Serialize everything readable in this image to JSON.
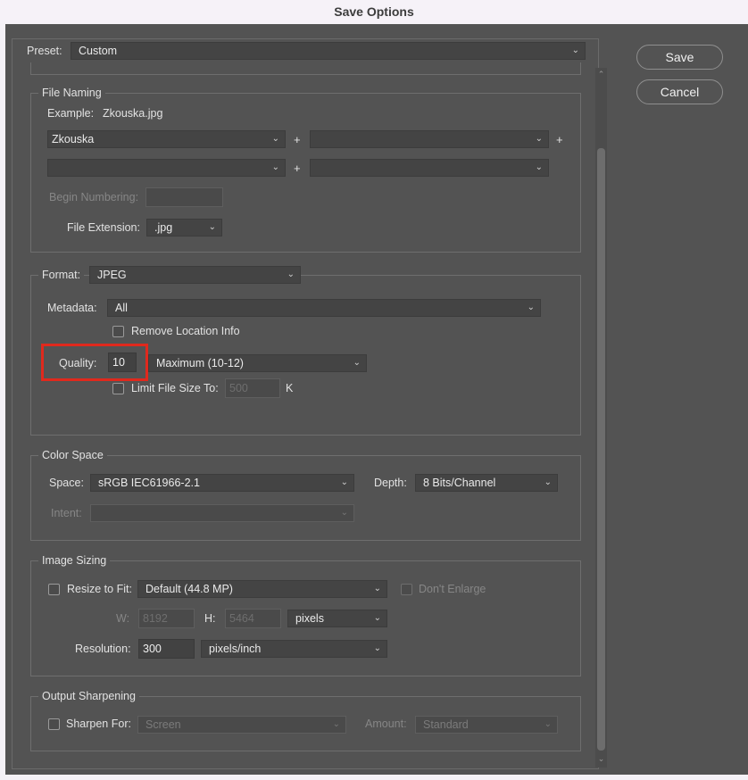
{
  "window": {
    "title": "Save Options"
  },
  "buttons": {
    "save": "Save",
    "cancel": "Cancel"
  },
  "preset": {
    "label": "Preset:",
    "value": "Custom"
  },
  "file_naming": {
    "legend": "File Naming",
    "example_label": "Example:",
    "example_value": "Zkouska.jpg",
    "name_field_1": "Zkouska",
    "name_field_2": "",
    "name_field_3": "",
    "name_field_4": "",
    "plus": "+",
    "begin_numbering_label": "Begin Numbering:",
    "begin_numbering_value": "",
    "extension_label": "File Extension:",
    "extension_value": ".jpg"
  },
  "format": {
    "label": "Format:",
    "value": "JPEG",
    "metadata_label": "Metadata:",
    "metadata_value": "All",
    "remove_location_label": "Remove Location Info",
    "remove_location_checked": false,
    "quality_label": "Quality:",
    "quality_value": "10",
    "quality_preset": "Maximum  (10-12)",
    "limit_size_label": "Limit File Size To:",
    "limit_size_checked": false,
    "limit_size_value": "500",
    "limit_size_unit": "K",
    "highlight_color": "#e0291d"
  },
  "color_space": {
    "legend": "Color Space",
    "space_label": "Space:",
    "space_value": "sRGB IEC61966-2.1",
    "depth_label": "Depth:",
    "depth_value": "8 Bits/Channel",
    "intent_label": "Intent:",
    "intent_value": ""
  },
  "image_sizing": {
    "legend": "Image Sizing",
    "resize_label": "Resize to Fit:",
    "resize_checked": false,
    "resize_value": "Default  (44.8 MP)",
    "dont_enlarge_label": "Don't Enlarge",
    "dont_enlarge_checked": false,
    "w_label": "W:",
    "w_value": "8192",
    "h_label": "H:",
    "h_value": "5464",
    "units_value": "pixels",
    "resolution_label": "Resolution:",
    "resolution_value": "300",
    "resolution_units": "pixels/inch"
  },
  "output_sharpening": {
    "legend": "Output Sharpening",
    "sharpen_label": "Sharpen For:",
    "sharpen_checked": false,
    "sharpen_value": "Screen",
    "amount_label": "Amount:",
    "amount_value": "Standard"
  },
  "icons": {
    "chevron": "chevron-down-icon",
    "scroll_up": "scroll-up-arrow-icon",
    "scroll_down": "scroll-down-arrow-icon"
  }
}
